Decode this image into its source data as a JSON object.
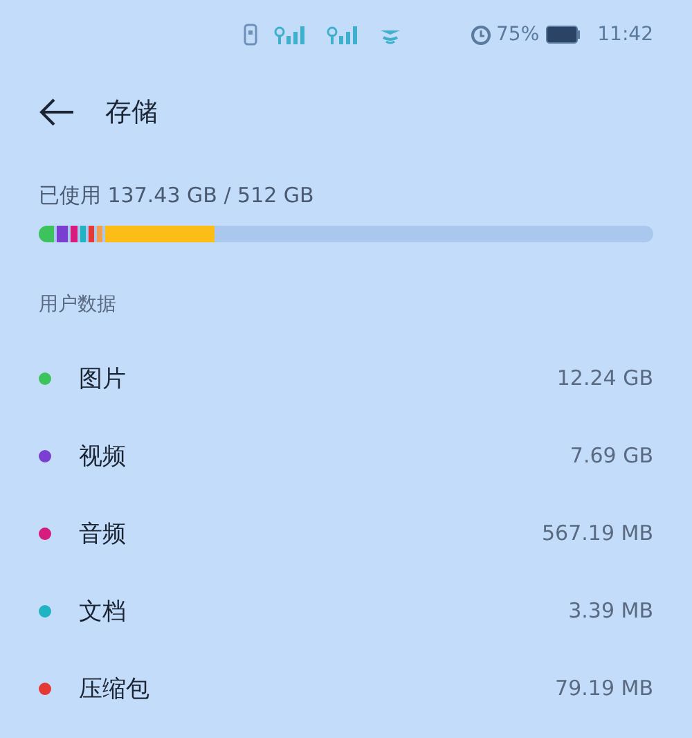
{
  "status_bar": {
    "battery_percent": "75%",
    "time": "11:42"
  },
  "header": {
    "title": "存储"
  },
  "usage": {
    "label": "已使用 137.43 GB / 512 GB",
    "segments": [
      {
        "color": "#3dc35b",
        "level": 0.025
      },
      {
        "color": "#7a3fd0",
        "level": 0.018
      },
      {
        "color": "#d61c7c",
        "level": 0.01
      },
      {
        "color": "#20b3c2"
      },
      {
        "color": "#e53935"
      },
      {
        "color": "#f0a050"
      },
      {
        "color": "#fcbd16",
        "level": 0.18
      }
    ]
  },
  "section": {
    "title": "用户数据"
  },
  "items": [
    {
      "name": "图片",
      "size": "12.24 GB",
      "color": "#3dc35b"
    },
    {
      "name": "视频",
      "size": "7.69 GB",
      "color": "#7a3fd0"
    },
    {
      "name": "音频",
      "size": "567.19 MB",
      "color": "#d61c7c"
    },
    {
      "name": "文档",
      "size": "3.39 MB",
      "color": "#20b3c2"
    },
    {
      "name": "压缩包",
      "size": "79.19 MB",
      "color": "#e53935"
    }
  ]
}
